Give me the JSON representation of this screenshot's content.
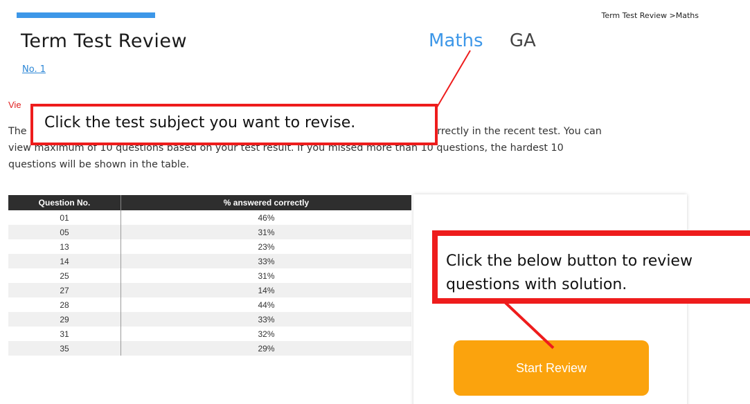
{
  "header": {
    "breadcrumb": "Term Test Review >Maths",
    "title": "Term Test Review",
    "review_no": "No. 1"
  },
  "subjects": [
    {
      "label": "Maths",
      "active": true
    },
    {
      "label": "GA",
      "active": false
    }
  ],
  "period": "Vie",
  "description": {
    "line1_start": "The",
    "line1_end": "red incorrectly in the recent test. You can",
    "line2": "view maximum of 10 questions based on your test result. If you missed more than 10 questions, the hardest 10",
    "line3": "questions will be shown in the table."
  },
  "table": {
    "headers": [
      "Question No.",
      "% answered correctly"
    ],
    "rows": [
      [
        "01",
        "46%"
      ],
      [
        "05",
        "31%"
      ],
      [
        "13",
        "23%"
      ],
      [
        "14",
        "33%"
      ],
      [
        "25",
        "31%"
      ],
      [
        "27",
        "14%"
      ],
      [
        "28",
        "44%"
      ],
      [
        "29",
        "33%"
      ],
      [
        "31",
        "32%"
      ],
      [
        "35",
        "29%"
      ]
    ]
  },
  "start_review_label": "Start Review",
  "callouts": {
    "subject": "Click the test subject you want to revise.",
    "review_line1": "Click the below button to review",
    "review_line2": "questions with solution."
  },
  "colors": {
    "accent_blue": "#3d97e8",
    "period_red": "#e02020",
    "callout_red": "#ee1c1c",
    "button_orange": "#fba30d",
    "table_header": "#2e2e2e"
  }
}
